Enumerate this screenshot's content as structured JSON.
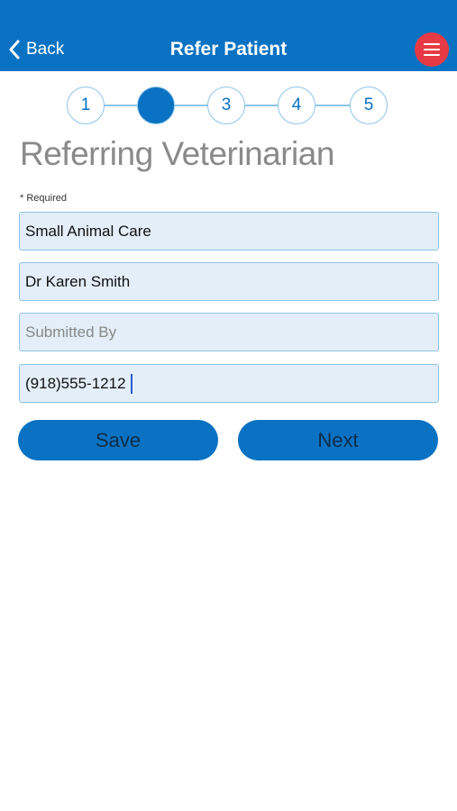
{
  "header": {
    "back_label": "Back",
    "title": "Refer Patient",
    "menu_icon": "hamburger-icon"
  },
  "stepper": {
    "steps": [
      "1",
      "",
      "3",
      "4",
      "5"
    ],
    "active_step": 2
  },
  "form": {
    "title": "Referring Veterinarian",
    "required_note": "* Required",
    "fields": [
      {
        "value": "Small Animal Care",
        "placeholder": ""
      },
      {
        "value": "Dr Karen Smith",
        "placeholder": ""
      },
      {
        "value": "",
        "placeholder": "Submitted By"
      },
      {
        "value": "(918)555-1212",
        "placeholder": ""
      }
    ]
  },
  "actions": {
    "save_label": "Save",
    "next_label": "Next"
  },
  "colors": {
    "primary": "#0a72c2",
    "menu_button": "#e63a45",
    "field_background": "#e3eef8",
    "field_border": "#8ec5e8"
  }
}
